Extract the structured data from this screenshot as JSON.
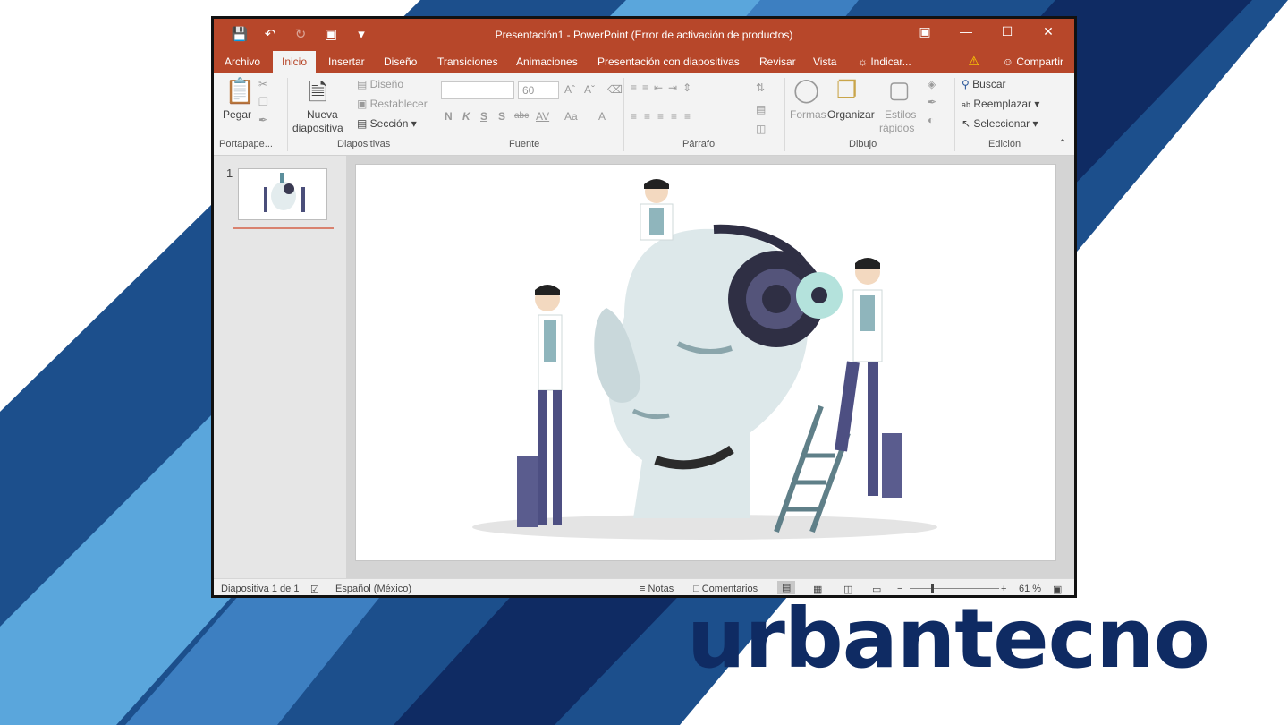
{
  "brand": {
    "name": "urbantecno"
  },
  "window": {
    "title": "Presentación1 - PowerPoint (Error de activación de productos)",
    "qat": [
      "save-icon",
      "undo-icon",
      "redo-icon",
      "start-from-beginning-icon",
      "customize-icon"
    ]
  },
  "tabs": [
    "Archivo",
    "Inicio",
    "Insertar",
    "Diseño",
    "Transiciones",
    "Animaciones",
    "Presentación con diapositivas",
    "Revisar",
    "Vista",
    "Indicar..."
  ],
  "active_tab": "Inicio",
  "share_label": "Compartir",
  "ribbon": {
    "portapapeles": {
      "paste": "Pegar",
      "label": "Portapape..."
    },
    "diapositivas": {
      "new1": "Nueva",
      "new2": "diapositiva",
      "layout": "Diseño",
      "reset": "Restablecer",
      "section": "Sección",
      "label": "Diapositivas"
    },
    "fuente": {
      "size": "60",
      "bold": "N",
      "italic": "K",
      "underline": "S",
      "shadow": "S",
      "strike": "abc",
      "spacing": "AV",
      "case": "Aa",
      "color": "A",
      "label": "Fuente"
    },
    "parrafo": {
      "label": "Párrafo"
    },
    "dibujo": {
      "shapes": "Formas",
      "arrange": "Organizar",
      "styles1": "Estilos",
      "styles2": "rápidos",
      "label": "Dibujo"
    },
    "edicion": {
      "find": "Buscar",
      "replace": "Reemplazar",
      "select": "Seleccionar",
      "label": "Edición"
    }
  },
  "thumbnails": {
    "number": "1"
  },
  "status": {
    "slide": "Diapositiva 1 de 1",
    "language": "Español (México)",
    "notes": "Notas",
    "comments": "Comentarios",
    "zoom": "61 %"
  },
  "colors": {
    "accent": "#b7472a",
    "brand": "#0f2b63"
  }
}
